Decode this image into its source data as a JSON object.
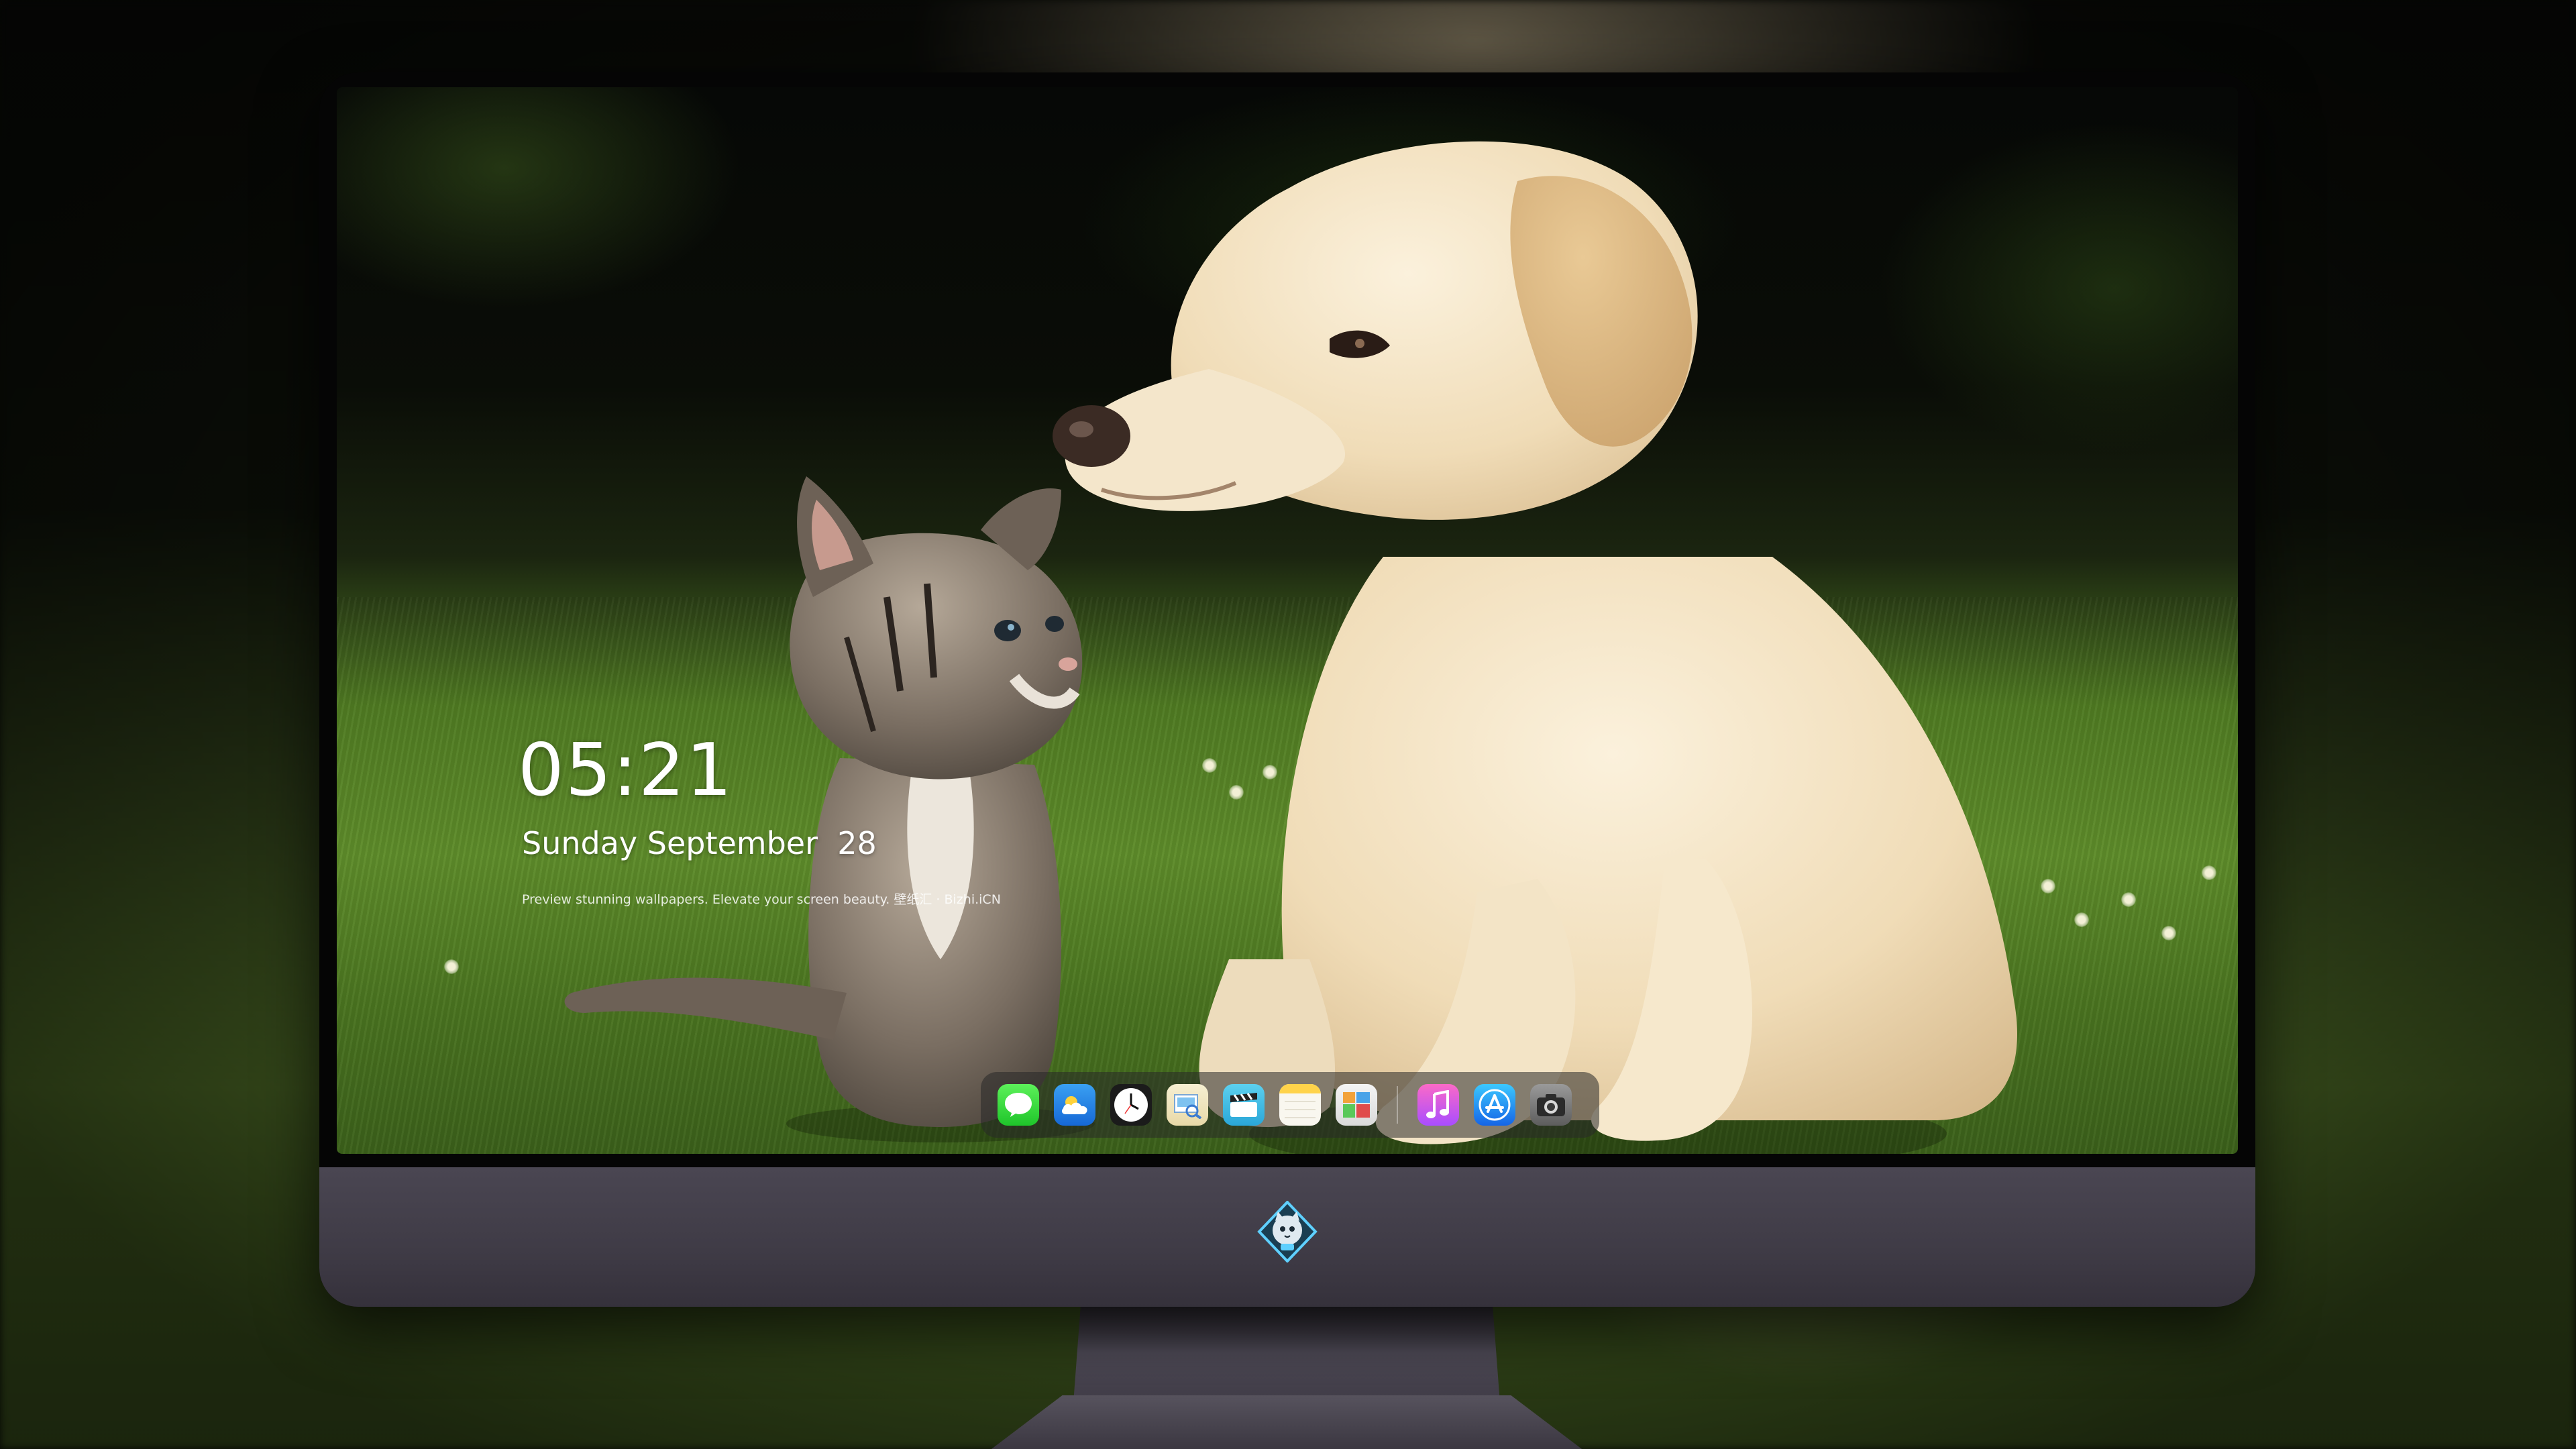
{
  "lock_screen": {
    "time": "05:21",
    "date": "Sunday September  28",
    "tagline": "Preview stunning wallpapers. Elevate your screen beauty. 壁纸汇 · Bizhi.iCN"
  },
  "wallpaper": {
    "subject": "puppy-and-kitten"
  },
  "dock": {
    "apps": [
      {
        "name": "Messages",
        "icon": "messages-icon"
      },
      {
        "name": "Weather",
        "icon": "weather-icon"
      },
      {
        "name": "Clock",
        "icon": "clock-icon"
      },
      {
        "name": "Preview",
        "icon": "preview-icon"
      },
      {
        "name": "Clips",
        "icon": "clips-icon"
      },
      {
        "name": "Notes",
        "icon": "notes-icon"
      },
      {
        "name": "Photos",
        "icon": "photos-icon"
      }
    ],
    "pinned": [
      {
        "name": "Music",
        "icon": "music-icon"
      },
      {
        "name": "App Store",
        "icon": "app-store-icon"
      },
      {
        "name": "Camera",
        "icon": "camera-icon"
      }
    ]
  },
  "monitor": {
    "chin_logo": "cat-mascot-logo"
  },
  "colors": {
    "bezel": "#050505",
    "chin": "#403c47",
    "grass": "#5e8c2a"
  }
}
